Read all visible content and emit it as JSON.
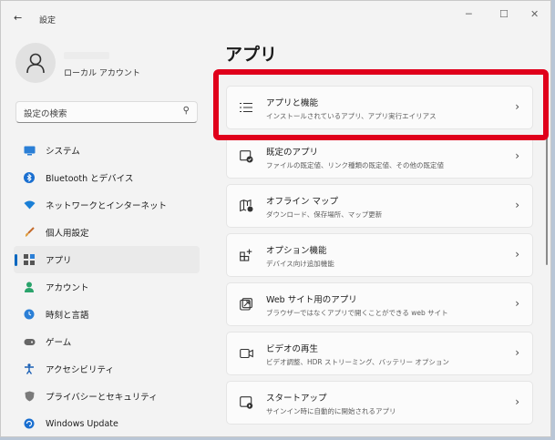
{
  "window": {
    "title": "設定",
    "back_icon": "arrow-left-icon",
    "controls": {
      "minimize": "─",
      "maximize": "☐",
      "close": "✕"
    }
  },
  "user": {
    "account_type": "ローカル アカウント"
  },
  "search": {
    "placeholder": "設定の検索",
    "icon": "search-icon"
  },
  "sidebar": {
    "items": [
      {
        "label": "システム",
        "icon": "monitor-icon",
        "active": false
      },
      {
        "label": "Bluetooth とデバイス",
        "icon": "bluetooth-icon",
        "active": false
      },
      {
        "label": "ネットワークとインターネット",
        "icon": "wifi-icon",
        "active": false
      },
      {
        "label": "個人用設定",
        "icon": "brush-icon",
        "active": false
      },
      {
        "label": "アプリ",
        "icon": "apps-icon",
        "active": true
      },
      {
        "label": "アカウント",
        "icon": "person-icon",
        "active": false
      },
      {
        "label": "時刻と言語",
        "icon": "globe-clock-icon",
        "active": false
      },
      {
        "label": "ゲーム",
        "icon": "gamepad-icon",
        "active": false
      },
      {
        "label": "アクセシビリティ",
        "icon": "accessibility-icon",
        "active": false
      },
      {
        "label": "プライバシーとセキュリティ",
        "icon": "shield-icon",
        "active": false
      },
      {
        "label": "Windows Update",
        "icon": "update-icon",
        "active": false
      }
    ]
  },
  "main": {
    "title": "アプリ",
    "cards": [
      {
        "title": "アプリと機能",
        "subtitle": "インストールされているアプリ、アプリ実行エイリアス",
        "icon": "list-icon"
      },
      {
        "title": "既定のアプリ",
        "subtitle": "ファイルの既定値、リンク種類の既定値、その他の既定値",
        "icon": "default-apps-icon"
      },
      {
        "title": "オフライン マップ",
        "subtitle": "ダウンロード、保存場所、マップ更新",
        "icon": "map-icon"
      },
      {
        "title": "オプション機能",
        "subtitle": "デバイス向け追加機能",
        "icon": "add-feature-icon"
      },
      {
        "title": "Web サイト用のアプリ",
        "subtitle": "ブラウザーではなくアプリで開くことができる web サイト",
        "icon": "open-in-app-icon"
      },
      {
        "title": "ビデオの再生",
        "subtitle": "ビデオ調整、HDR ストリーミング、バッテリー オプション",
        "icon": "video-icon"
      },
      {
        "title": "スタートアップ",
        "subtitle": "サインイン時に自動的に開始されるアプリ",
        "icon": "startup-icon"
      }
    ],
    "highlight_color": "#e0001b"
  },
  "colors": {
    "accent": "#0067c0",
    "background": "#f3f3f3",
    "card": "#fbfbfb"
  }
}
